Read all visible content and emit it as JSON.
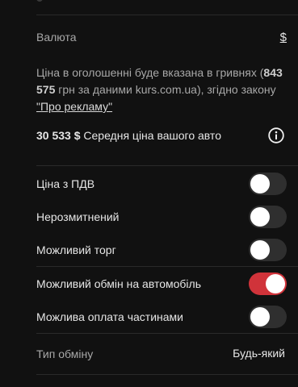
{
  "currency": {
    "label": "Валюта",
    "value": "$"
  },
  "price_info": {
    "text_before": "Ціна в оголошенні буде вказана в гривнях (",
    "uah_amount": "843 575",
    "text_middle": " грн за даними kurs.com.ua), згідно закону ",
    "law_link": "\"Про рекламу\""
  },
  "average_price": {
    "amount": "30 533 $",
    "label": "Середня ціна вашого авто",
    "icon": "info-icon"
  },
  "options": [
    {
      "label": "Ціна з ПДВ",
      "enabled": false
    },
    {
      "label": "Нерозмитнений",
      "enabled": false
    },
    {
      "label": "Можливий торг",
      "enabled": false
    },
    {
      "label": "Можливий обмін на автомобіль",
      "enabled": true
    },
    {
      "label": "Можлива оплата частинами",
      "enabled": false
    }
  ],
  "exchange_type": {
    "label": "Тип обміну",
    "value": "Будь-який"
  },
  "colors": {
    "background": "#111111",
    "accent": "#d0333a",
    "toggle_off": "#2f2f2f"
  }
}
